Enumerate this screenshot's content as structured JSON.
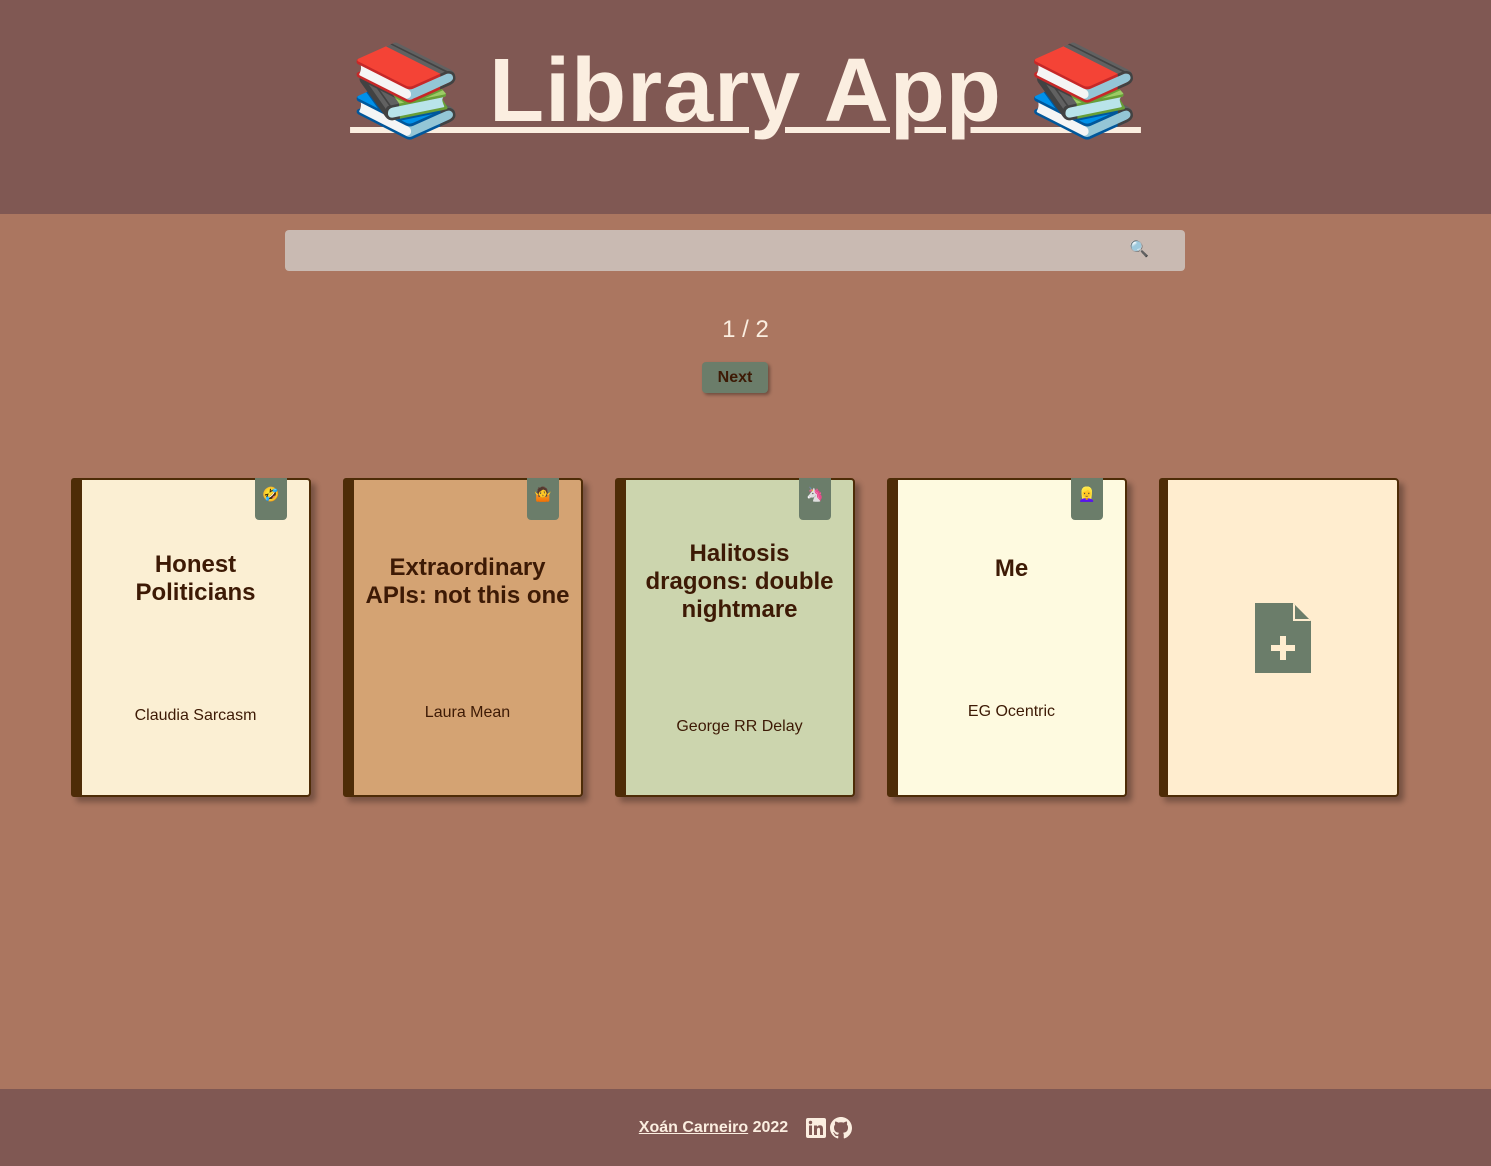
{
  "header": {
    "title": "📚 Library App 📚"
  },
  "search": {
    "placeholder": "",
    "value": "",
    "icon": "🔍"
  },
  "pagination": {
    "current": "1 / 2",
    "next_label": "Next"
  },
  "books": [
    {
      "title": "Honest Politicians",
      "author": "Claudia Sarcasm",
      "tag": "🤣",
      "color": "#fbefd3"
    },
    {
      "title": "Extraordinary APIs: not this one",
      "author": "Laura Mean",
      "tag": "🤷",
      "color": "#d4a373"
    },
    {
      "title": "Halitosis dragons: double nightmare",
      "author": "George RR Delay",
      "tag": "🦄",
      "color": "#ccd5ae"
    },
    {
      "title": "Me",
      "author": "EG Ocentric",
      "tag": "👱‍♀️",
      "color": "#fefae0"
    }
  ],
  "add_card": {
    "color": "#ffedcf"
  },
  "footer": {
    "author": "Xoán Carneiro",
    "year": "2022"
  }
}
